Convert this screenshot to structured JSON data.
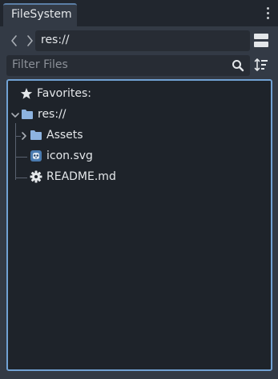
{
  "dock": {
    "tab_label": "FileSystem"
  },
  "navigation": {
    "current_path": "res://"
  },
  "filter": {
    "placeholder": "Filter Files"
  },
  "tree": {
    "favorites_label": "Favorites:",
    "root_label": "res://",
    "items": [
      {
        "label": "Assets",
        "icon": "folder-icon"
      },
      {
        "label": "icon.svg",
        "icon": "godot-icon"
      },
      {
        "label": "README.md",
        "icon": "gear-file-icon"
      }
    ]
  },
  "colors": {
    "accent": "#71a2d4",
    "folder": "#8db3e0",
    "panel": "#333a45",
    "tree_bg": "#1e232a"
  }
}
